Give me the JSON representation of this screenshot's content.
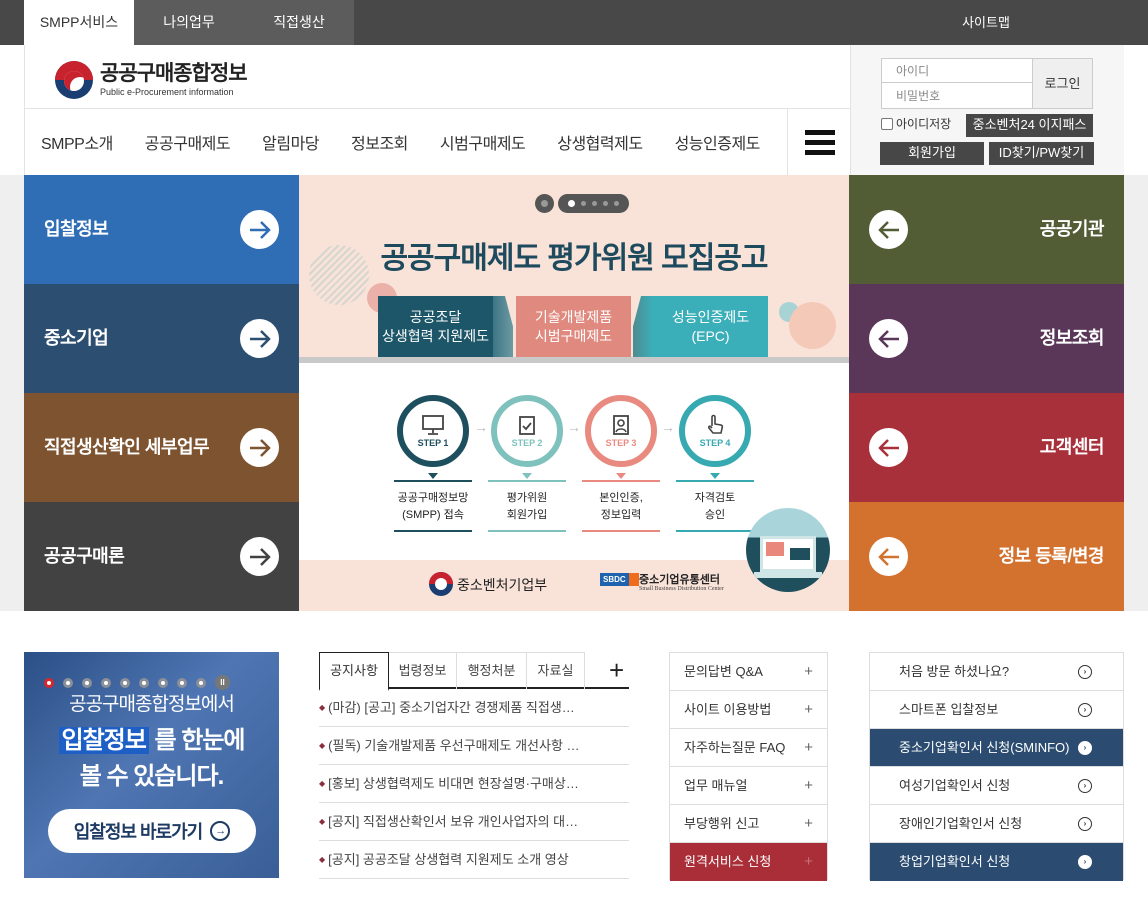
{
  "topbar": {
    "tabs": [
      {
        "label": "SMPP서비스",
        "active": true
      },
      {
        "label": "나의업무",
        "active": false
      },
      {
        "label": "직접생산",
        "active": false
      }
    ],
    "sitemap": "사이트맵"
  },
  "header": {
    "logo_ko": "공공구매종합정보",
    "logo_en": "Public e-Procurement information",
    "gnb": [
      "SMPP소개",
      "공공구매제도",
      "알림마당",
      "정보조회",
      "시범구매제도",
      "상생협력제도",
      "성능인증제도"
    ],
    "menu_icon": "hamburger-icon"
  },
  "login": {
    "id_placeholder": "아이디",
    "pw_placeholder": "비밀번호",
    "login_button": "로그인",
    "save_id": "아이디저장",
    "easypass": "중소벤처24 이지패스",
    "join": "회원가입",
    "find": "ID찾기/PW찾기"
  },
  "left_panels": [
    {
      "label": "입찰정보",
      "color": "#2f6db5",
      "icon": "arrow-right-icon"
    },
    {
      "label": "중소기업",
      "color": "#2c4e70",
      "icon": "arrow-right-icon"
    },
    {
      "label": "직접생산확인 세부업무",
      "color": "#7e5430",
      "icon": "arrow-right-icon"
    },
    {
      "label": "공공구매론",
      "color": "#424242",
      "icon": "arrow-right-icon"
    }
  ],
  "right_panels": [
    {
      "label": "공공기관",
      "color": "#525c35",
      "icon": "arrow-left-icon"
    },
    {
      "label": "정보조회",
      "color": "#5a3659",
      "icon": "arrow-left-icon"
    },
    {
      "label": "고객센터",
      "color": "#a8303a",
      "icon": "arrow-left-icon"
    },
    {
      "label": "정보 등록/변경",
      "color": "#d2722e",
      "icon": "arrow-left-icon"
    }
  ],
  "banner": {
    "title": "공공구매제도 평가위원 모집공고",
    "slide_count": 5,
    "active_slide": 1,
    "boxes": [
      {
        "line1": "공공조달",
        "line2": "상생협력 지원제도",
        "color": "#1d5668"
      },
      {
        "line1": "기술개발제품",
        "line2": "시범구매제도",
        "color": "#e0897e"
      },
      {
        "line1": "성능인증제도",
        "line2": "(EPC)",
        "color": "#3bafb9"
      }
    ],
    "steps": [
      {
        "label": "STEP 1",
        "cap1": "공공구매정보망",
        "cap2": "(SMPP) 접속",
        "color": "#1d4f5f",
        "icon": "monitor-icon"
      },
      {
        "label": "STEP 2",
        "cap1": "평가위원",
        "cap2": "회원가입",
        "color": "#7fc2bd",
        "icon": "clipboard-check-icon"
      },
      {
        "label": "STEP 3",
        "cap1": "본인인증,",
        "cap2": "정보입력",
        "color": "#e98a80",
        "icon": "id-card-icon"
      },
      {
        "label": "STEP 4",
        "cap1": "자격검토",
        "cap2": "승인",
        "color": "#36a9b1",
        "icon": "hand-pointer-icon"
      }
    ],
    "org1": "중소벤처기업부",
    "org2_badge": "SBDC",
    "org2_ko": "중소기업유통센터",
    "org2_en": "Small Business Distribution Center"
  },
  "promo": {
    "slide_count": 9,
    "active_slide": 1,
    "pause": "II",
    "line1": "공공구매종합정보에서",
    "highlight": "입찰정보",
    "line2_rest": " 를 한눈에",
    "line3": "볼 수 있습니다.",
    "button": "입찰정보 바로가기"
  },
  "notice": {
    "tabs": [
      "공지사항",
      "법령정보",
      "행정처분",
      "자료실"
    ],
    "active_tab": 0,
    "more": "+",
    "items": [
      "(마감) [공고] 중소기업자간 경쟁제품 직접생…",
      "(필독) 기술개발제품 우선구매제도 개선사항 …",
      "[홍보] 상생협력제도 비대면 현장설명·구매상…",
      "[공지] 직접생산확인서 보유 개인사업자의 대…",
      "[공지] 공공조달 상생협력 지원제도 소개 영상"
    ]
  },
  "quick_links": [
    {
      "label": "문의답변 Q&A",
      "highlight": false
    },
    {
      "label": "사이트 이용방법",
      "highlight": false
    },
    {
      "label": "자주하는질문 FAQ",
      "highlight": false
    },
    {
      "label": "업무 매뉴얼",
      "highlight": false
    },
    {
      "label": "부당행위 신고",
      "highlight": false
    },
    {
      "label": "원격서비스 신청",
      "highlight": true
    }
  ],
  "cert_links": [
    {
      "label": "처음 방문 하셨나요?",
      "dark": false
    },
    {
      "label": "스마트폰 입찰정보",
      "dark": false
    },
    {
      "label": "중소기업확인서 신청(SMINFO)",
      "dark": true
    },
    {
      "label": "여성기업확인서 신청",
      "dark": false
    },
    {
      "label": "장애인기업확인서 신청",
      "dark": false
    },
    {
      "label": "창업기업확인서 신청",
      "dark": true
    }
  ]
}
